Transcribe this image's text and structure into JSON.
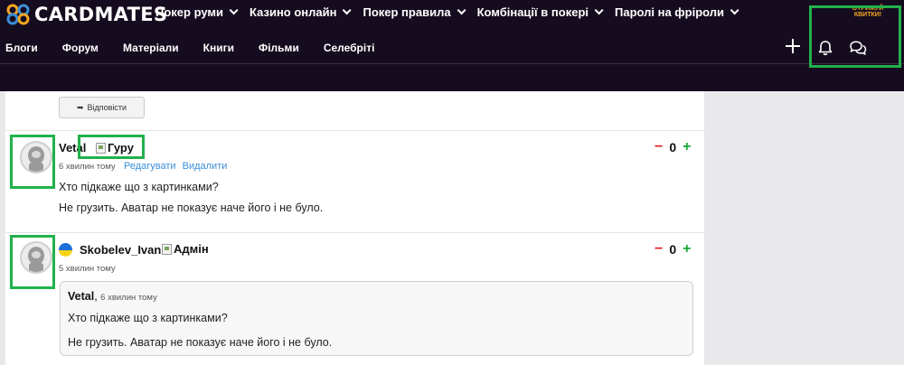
{
  "header": {
    "brand": "CARDMATES",
    "main_nav": [
      {
        "label": "Покер руми"
      },
      {
        "label": "Казино онлайн"
      },
      {
        "label": "Покер правила"
      },
      {
        "label": "Комбінації в покері"
      },
      {
        "label": "Паролі на фріроли"
      }
    ],
    "sub_nav": [
      {
        "label": "Блоги"
      },
      {
        "label": "Форум"
      },
      {
        "label": "Матеріали"
      },
      {
        "label": "Книги"
      },
      {
        "label": "Фільми"
      },
      {
        "label": "Селебріті"
      }
    ],
    "tickets_label": "ОТРИМУЙ КВИТКИ!"
  },
  "thread": {
    "reply_label": "Відповісти",
    "comments": [
      {
        "author": "Vetal",
        "badge": "Гуру",
        "time": "6 хвилин тому",
        "edit_label": "Редагувати",
        "delete_label": "Видалити",
        "lines": [
          "Хто підкаже що з картинками?",
          "Не грузить. Аватар не показує наче його і не було."
        ],
        "vote": {
          "minus": "−",
          "score": "0",
          "plus": "+"
        }
      },
      {
        "author": "Skobelev_Ivan",
        "badge": "Адмін",
        "time": "5 хвилин тому",
        "vote": {
          "minus": "−",
          "score": "0",
          "plus": "+"
        },
        "quote": {
          "author": "Vetal",
          "time": "6 хвилин тому",
          "lines": [
            "Хто підкаже що з картинками?",
            "Не грузить. Аватар не показує наче його і не було."
          ]
        }
      }
    ]
  },
  "colors": {
    "header_bg": "#160c1f",
    "accent_link": "#3a8fd8",
    "vote_minus": "#e02424",
    "vote_plus": "#1aa83a",
    "highlight": "#22b14c",
    "tickets": "#f5a623"
  },
  "icons": [
    "logo-icon",
    "plus-icon",
    "bell-icon",
    "chat-icon",
    "reply-arrow-icon",
    "avatar-placeholder-icon",
    "broken-image-icon",
    "ukraine-flag-icon"
  ]
}
